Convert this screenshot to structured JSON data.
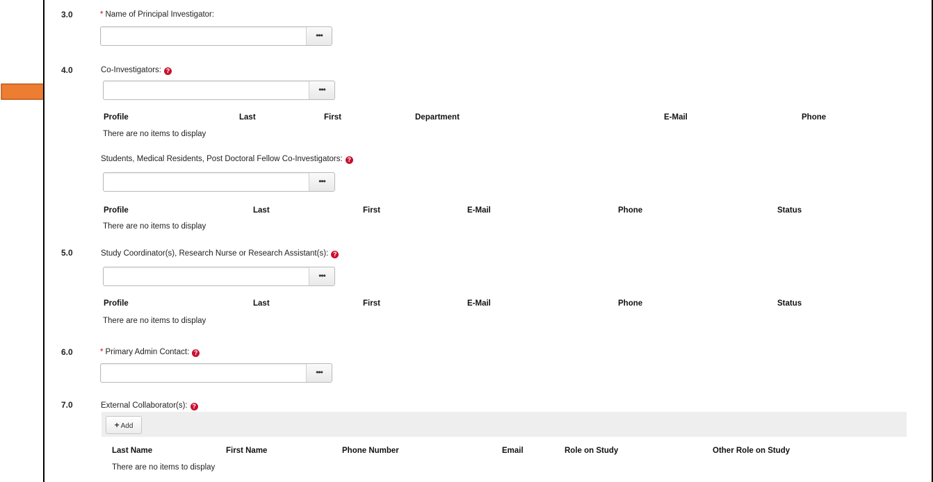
{
  "help_glyph": "?",
  "browse_glyph": "•••",
  "empty_text": "There are no items to display",
  "required_mark": "*",
  "sec3": {
    "num": "3.0",
    "label": "Name of Principal Investigator:"
  },
  "sec4": {
    "num": "4.0",
    "label": "Co-Investigators:",
    "columns": [
      "Profile",
      "Last",
      "First",
      "Department",
      "E-Mail",
      "Phone"
    ],
    "sub": {
      "label": "Students, Medical Residents, Post Doctoral Fellow Co-Investigators:",
      "columns": [
        "Profile",
        "Last",
        "First",
        "E-Mail",
        "Phone",
        "Status"
      ]
    }
  },
  "sec5": {
    "num": "5.0",
    "label": "Study Coordinator(s), Research Nurse or Research Assistant(s):",
    "columns": [
      "Profile",
      "Last",
      "First",
      "E-Mail",
      "Phone",
      "Status"
    ]
  },
  "sec6": {
    "num": "6.0",
    "label": "Primary Admin Contact:"
  },
  "sec7": {
    "num": "7.0",
    "label": "External Collaborator(s):",
    "add_label": "Add",
    "columns": [
      "Last Name",
      "First Name",
      "Phone Number",
      "Email",
      "Role on Study",
      "Other Role on Study"
    ]
  },
  "colors": {
    "arrow": "#ed7d31",
    "arrow_stroke": "#b85a1c",
    "required": "#dd0000",
    "help": "#c8102e"
  }
}
